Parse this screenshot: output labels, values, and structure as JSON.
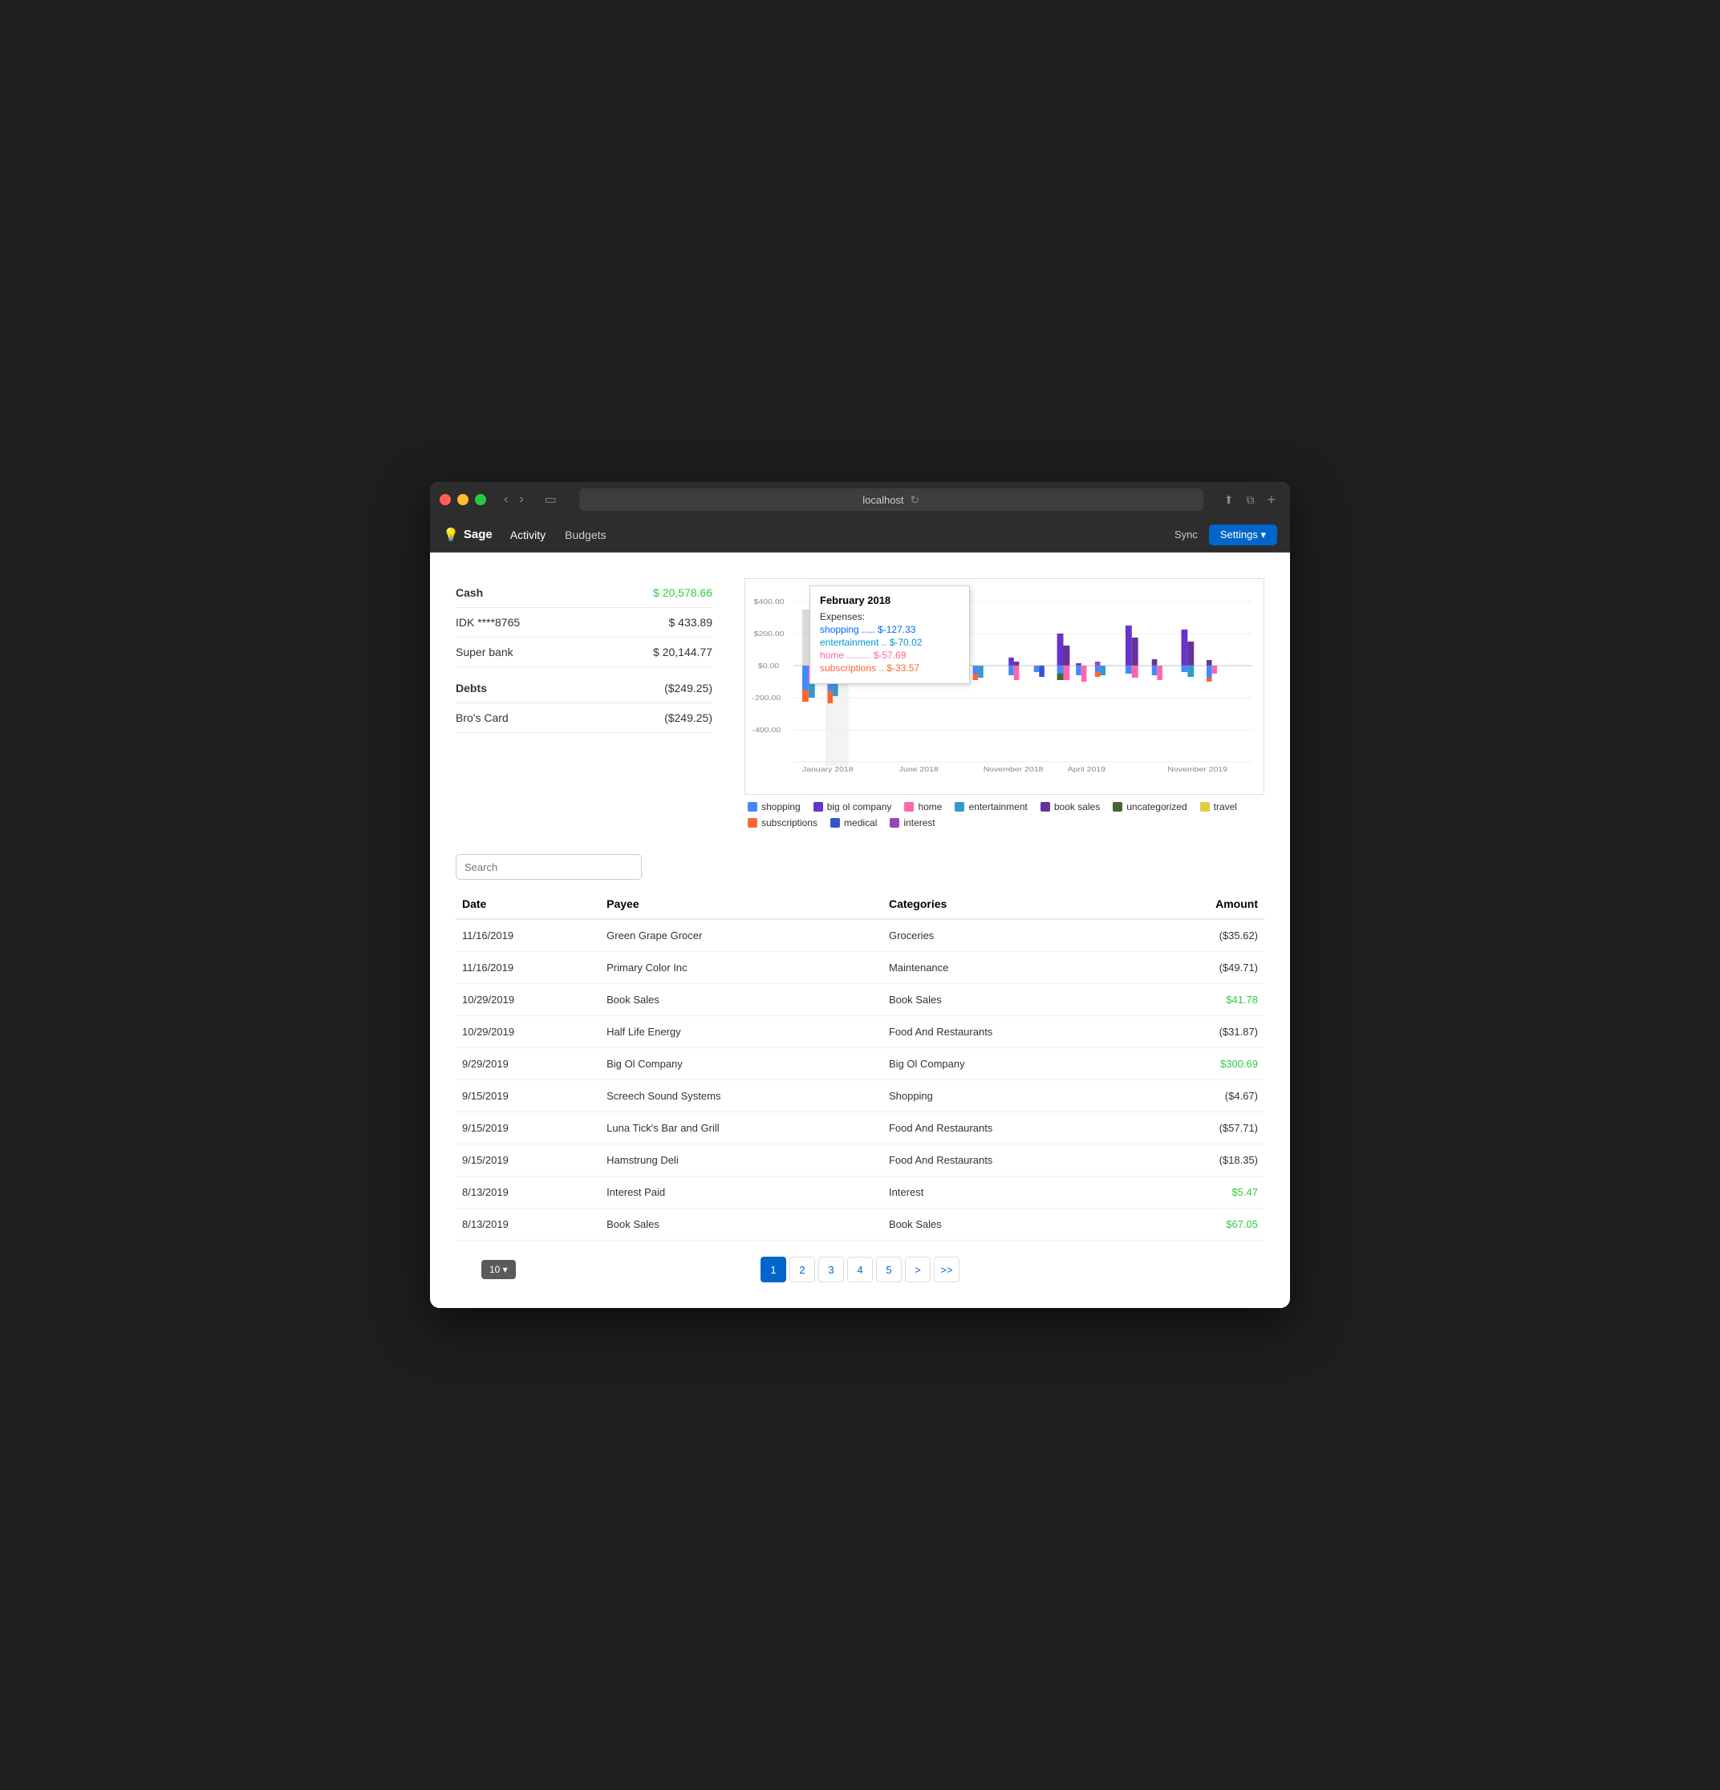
{
  "window": {
    "url": "localhost"
  },
  "nav": {
    "logo": "Sage",
    "logo_icon": "💡",
    "links": [
      "Activity",
      "Budgets"
    ],
    "active_link": "Activity",
    "sync_label": "Sync",
    "settings_label": "Settings ▾"
  },
  "accounts": {
    "cash_label": "Cash",
    "cash_amount": "$ 20,578.66",
    "accounts": [
      {
        "name": "IDK ****8765",
        "amount": "$ 433.89",
        "positive": false
      },
      {
        "name": "Super bank",
        "amount": "$ 20,144.77",
        "positive": false
      }
    ],
    "debts_label": "Debts",
    "debts_amount": "($249.25)",
    "debts": [
      {
        "name": "Bro's Card",
        "amount": "($249.25)",
        "positive": false
      }
    ]
  },
  "chart": {
    "tooltip": {
      "title": "February 2018",
      "expenses_label": "Expenses:",
      "shopping": "shopping ..... $-127.33",
      "entertainment": "entertainment .. $-70.02",
      "home": "home ......... $-57.69",
      "subscriptions": "subscriptions .. $-33.57"
    },
    "y_labels": [
      "$400.00",
      "$200.00",
      "$0.00",
      "$-200.00",
      "$-400.00"
    ],
    "x_labels": [
      "January 2018",
      "June 2018",
      "November 2018",
      "April 2019",
      "November 2019"
    ],
    "legend": [
      {
        "label": "shopping",
        "color": "#4488ff"
      },
      {
        "label": "big ol company",
        "color": "#6633cc"
      },
      {
        "label": "home",
        "color": "#ff66aa"
      },
      {
        "label": "entertainment",
        "color": "#3399cc"
      },
      {
        "label": "book sales",
        "color": "#663399"
      },
      {
        "label": "uncategorized",
        "color": "#446633"
      },
      {
        "label": "travel",
        "color": "#ddcc44"
      },
      {
        "label": "subscriptions",
        "color": "#ff6633"
      },
      {
        "label": "medical",
        "color": "#3355cc"
      },
      {
        "label": "interest",
        "color": "#9944bb"
      }
    ]
  },
  "search": {
    "placeholder": "Search"
  },
  "table": {
    "headers": [
      "Date",
      "Payee",
      "Categories",
      "Amount"
    ],
    "rows": [
      {
        "date": "11/16/2019",
        "payee": "Green Grape Grocer",
        "category": "Groceries",
        "amount": "($35.62)",
        "positive": false
      },
      {
        "date": "11/16/2019",
        "payee": "Primary Color Inc",
        "category": "Maintenance",
        "amount": "($49.71)",
        "positive": false
      },
      {
        "date": "10/29/2019",
        "payee": "Book Sales",
        "category": "Book Sales",
        "amount": "$41.78",
        "positive": true
      },
      {
        "date": "10/29/2019",
        "payee": "Half Life Energy",
        "category": "Food And Restaurants",
        "amount": "($31.87)",
        "positive": false
      },
      {
        "date": "9/29/2019",
        "payee": "Big Ol Company",
        "category": "Big Ol Company",
        "amount": "$300.69",
        "positive": true
      },
      {
        "date": "9/15/2019",
        "payee": "Screech Sound Systems",
        "category": "Shopping",
        "amount": "($4.67)",
        "positive": false
      },
      {
        "date": "9/15/2019",
        "payee": "Luna Tick's Bar and Grill",
        "category": "Food And Restaurants",
        "amount": "($57.71)",
        "positive": false
      },
      {
        "date": "9/15/2019",
        "payee": "Hamstrung Deli",
        "category": "Food And Restaurants",
        "amount": "($18.35)",
        "positive": false
      },
      {
        "date": "8/13/2019",
        "payee": "Interest Paid",
        "category": "Interest",
        "amount": "$5.47",
        "positive": true
      },
      {
        "date": "8/13/2019",
        "payee": "Book Sales",
        "category": "Book Sales",
        "amount": "$67.05",
        "positive": true
      }
    ]
  },
  "pagination": {
    "page_size": "10 ▾",
    "pages": [
      "1",
      "2",
      "3",
      "4",
      "5",
      ">",
      ">>"
    ],
    "active_page": "1"
  }
}
